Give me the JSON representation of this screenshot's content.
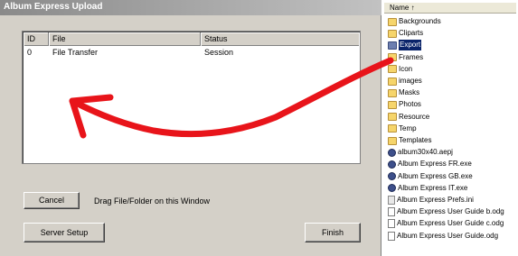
{
  "dialog": {
    "title": "Album Express Upload",
    "columns": [
      "ID",
      "File",
      "Status"
    ],
    "rows": [
      {
        "id": "0",
        "file": "File Transfer",
        "status": "Session"
      }
    ],
    "cancel_label": "Cancel",
    "drag_label": "Drag File/Folder on this Window",
    "server_setup_label": "Server Setup",
    "finish_label": "Finish"
  },
  "explorer": {
    "header": "Name  ↑",
    "items": [
      {
        "label": "Backgrounds",
        "icon": "folder-icon"
      },
      {
        "label": "Cliparts",
        "icon": "folder-icon"
      },
      {
        "label": "Export",
        "icon": "folder-icon",
        "selected": true
      },
      {
        "label": "Frames",
        "icon": "folder-icon"
      },
      {
        "label": "Icon",
        "icon": "folder-icon"
      },
      {
        "label": "images",
        "icon": "folder-icon"
      },
      {
        "label": "Masks",
        "icon": "folder-icon"
      },
      {
        "label": "Photos",
        "icon": "folder-icon"
      },
      {
        "label": "Resource",
        "icon": "folder-icon"
      },
      {
        "label": "Temp",
        "icon": "folder-icon"
      },
      {
        "label": "Templates",
        "icon": "folder-icon"
      },
      {
        "label": "album30x40.aepj",
        "icon": "project-file-icon"
      },
      {
        "label": "Album Express FR.exe",
        "icon": "exe-icon"
      },
      {
        "label": "Album Express GB.exe",
        "icon": "exe-icon"
      },
      {
        "label": "Album Express IT.exe",
        "icon": "exe-icon"
      },
      {
        "label": "Album Express Prefs.ini",
        "icon": "ini-file-icon"
      },
      {
        "label": "Album Express User Guide b.odg",
        "icon": "document-icon"
      },
      {
        "label": "Album Express User Guide c.odg",
        "icon": "document-icon"
      },
      {
        "label": "Album Express User Guide.odg",
        "icon": "document-icon"
      }
    ]
  },
  "annotation": {
    "arrow_color": "#e8141a"
  },
  "colors": {
    "dialog_bg": "#d4d0c8",
    "selection": "#0a246a",
    "folder": "#f6d56b"
  }
}
